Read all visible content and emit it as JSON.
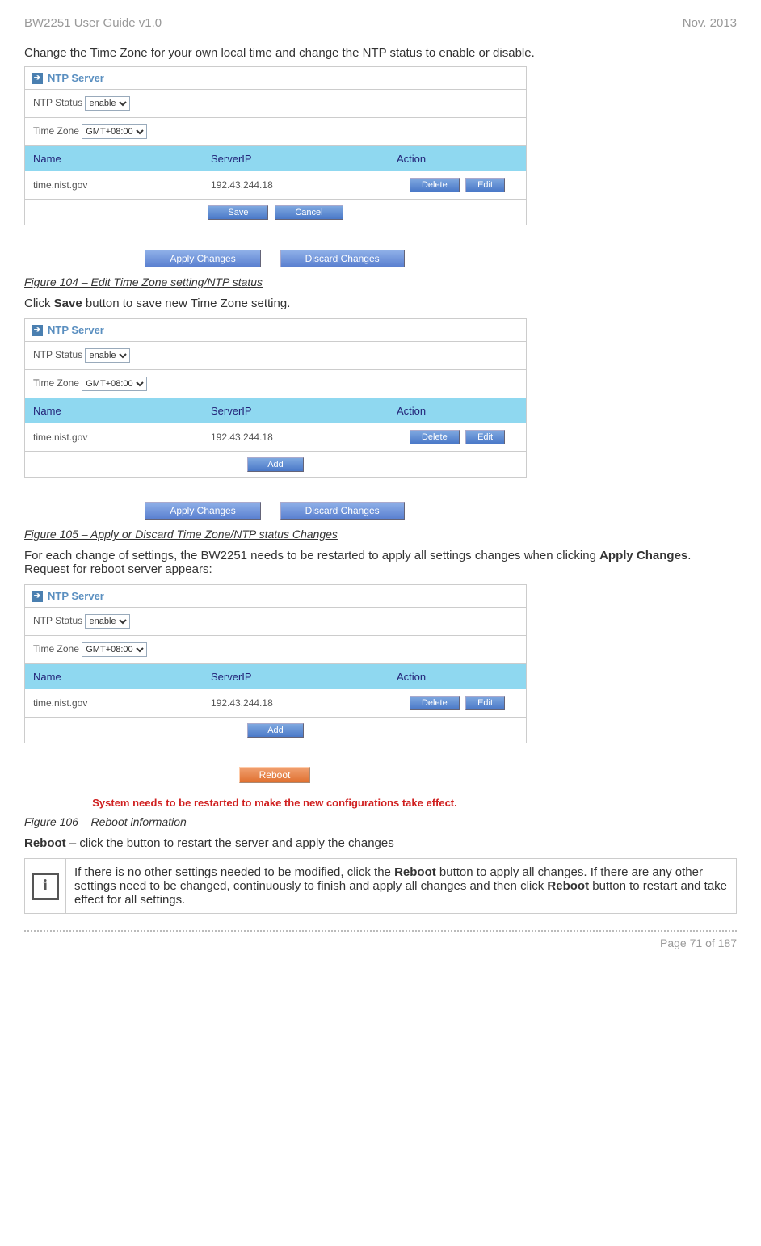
{
  "header": {
    "left": "BW2251 User Guide v1.0",
    "right": "Nov.  2013"
  },
  "intro": "Change the Time Zone for your own local time and change the NTP status to enable or disable.",
  "panel": {
    "title": "NTP Server",
    "ntp_label": "NTP Status",
    "ntp_value": "enable",
    "tz_label": "Time Zone",
    "tz_value": "GMT+08:00",
    "cols": {
      "name": "Name",
      "ip": "ServerIP",
      "action": "Action"
    },
    "row": {
      "name": "time.nist.gov",
      "ip": "192.43.244.18"
    },
    "btn": {
      "delete": "Delete",
      "edit": "Edit",
      "save": "Save",
      "cancel": "Cancel",
      "add": "Add",
      "apply": "Apply Changes",
      "discard": "Discard Changes",
      "reboot": "Reboot"
    }
  },
  "fig104": "Figure 104 – Edit Time Zone setting/NTP status",
  "text_save": {
    "pre": "Click ",
    "bold": "Save",
    "post": " button to save new Time Zone setting."
  },
  "fig105": "Figure 105 – Apply or Discard Time Zone/NTP status Changes",
  "text_apply": {
    "l1a": "For each change of settings, the BW2251 needs to be restarted to apply all settings changes when clicking ",
    "l1b": "Apply Changes",
    "l1c": ". Request for reboot server appears:"
  },
  "sys_msg": "System needs to be restarted to make the new configurations take effect.",
  "fig106": "Figure 106 – Reboot information",
  "text_reboot": {
    "bold": "Reboot",
    "rest": " – click the button to restart the server and apply the changes"
  },
  "info": {
    "a": "If there is no other settings needed to be modified, click the ",
    "b": "Reboot",
    "c": " button to apply all changes. If there are any other settings need to be changed, continuously to finish and apply all changes and then click ",
    "d": "Reboot",
    "e": " button to restart and take effect  for all settings."
  },
  "footer": "Page 71 of 187"
}
